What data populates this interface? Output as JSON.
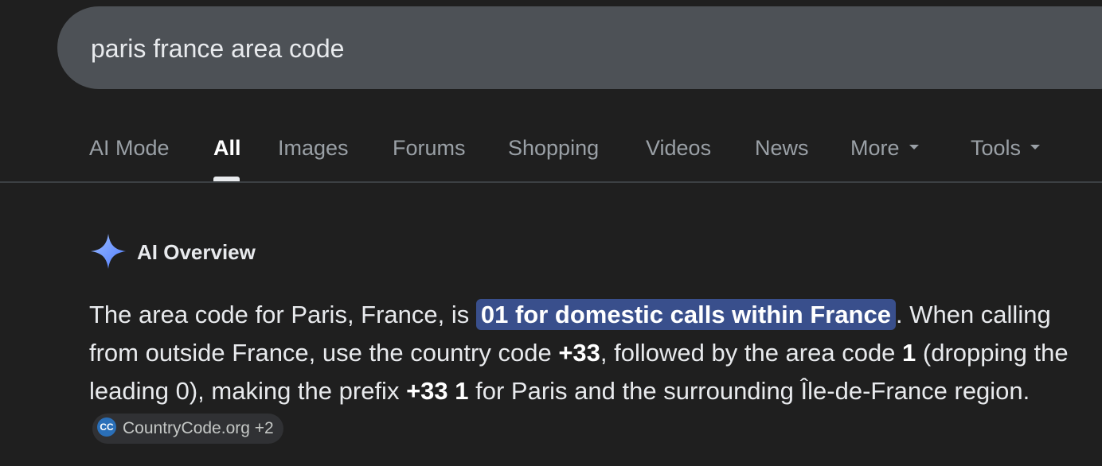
{
  "search": {
    "query": "paris france area code"
  },
  "tabs": [
    {
      "label": "AI Mode",
      "active": false
    },
    {
      "label": "All",
      "active": true
    },
    {
      "label": "Images",
      "active": false
    },
    {
      "label": "Forums",
      "active": false
    },
    {
      "label": "Shopping",
      "active": false
    },
    {
      "label": "Videos",
      "active": false
    },
    {
      "label": "News",
      "active": false
    },
    {
      "label": "More",
      "active": false,
      "dropdown": true
    },
    {
      "label": "Tools",
      "active": false,
      "dropdown": true
    }
  ],
  "ai_overview": {
    "icon": "sparkle-icon",
    "title": "AI Overview",
    "text_1": "The area code for Paris, France, is ",
    "highlight": "01 for domestic calls within France",
    "text_2": ". When calling from outside France, use the country code ",
    "bold_1": "+33",
    "text_3": ", followed by the area code ",
    "bold_2": "1",
    "text_4": " (dropping the leading 0), making the prefix ",
    "bold_3": "+33 1",
    "text_5": " for Paris and the surrounding Île-de-France region. ",
    "source": {
      "icon_text": "CC",
      "label": "CountryCode.org +2"
    }
  },
  "colors": {
    "background": "#1f1f1f",
    "search_bar": "#4d5156",
    "highlight": "#394f8c",
    "sparkle": "#7aa7ff"
  }
}
